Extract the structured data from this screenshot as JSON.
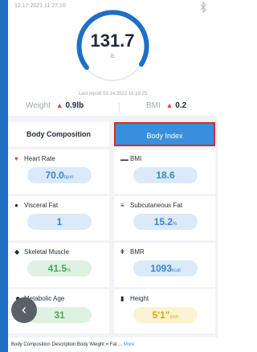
{
  "header": {
    "timestamp": "12.17.2021 11:27:10",
    "weight": "131.7",
    "unit": "lb",
    "last_report": "Last report 03.14.2022 16:19:25"
  },
  "changes": {
    "weight_label": "Weight",
    "weight_arrow": "▲",
    "weight_value": "0.9lb",
    "bmi_label": "BMI",
    "bmi_arrow": "▲",
    "bmi_value": "0.2"
  },
  "tabs": {
    "composition": "Body Composition",
    "index": "Body Index"
  },
  "metrics": {
    "heart_rate": {
      "label": "Heart Rate",
      "value": "70.0",
      "unit": "bpm",
      "icon": "heart-icon"
    },
    "bmi": {
      "label": "BMI",
      "value": "18.6",
      "unit": "",
      "icon": "bmi-icon"
    },
    "visceral_fat": {
      "label": "Visceral Fat",
      "value": "1",
      "unit": "",
      "icon": "visceral-fat-icon"
    },
    "subcutaneous_fat": {
      "label": "Subcutaneous Fat",
      "value": "15.2",
      "unit": "%",
      "icon": "subcutaneous-fat-icon"
    },
    "skeletal_muscle": {
      "label": "Skeletal Muscle",
      "value": "41.5",
      "unit": "%",
      "icon": "muscle-icon"
    },
    "bmr": {
      "label": "BMR",
      "value": "1093",
      "unit": "kcal",
      "icon": "flame-icon"
    },
    "metabolic_age": {
      "label": "Metabolic Age",
      "value": "31",
      "unit": "",
      "icon": "person-icon"
    },
    "height": {
      "label": "Height",
      "value": "5'1\"",
      "unit": "inch",
      "icon": "ruler-icon"
    }
  },
  "footer": {
    "text": "Body Composition Description:Body Weight = Fat ...",
    "more": "More"
  },
  "colors": {
    "accent": "#3a8fdc",
    "up_arrow": "#e0483d",
    "highlight_border": "#d82a30"
  }
}
